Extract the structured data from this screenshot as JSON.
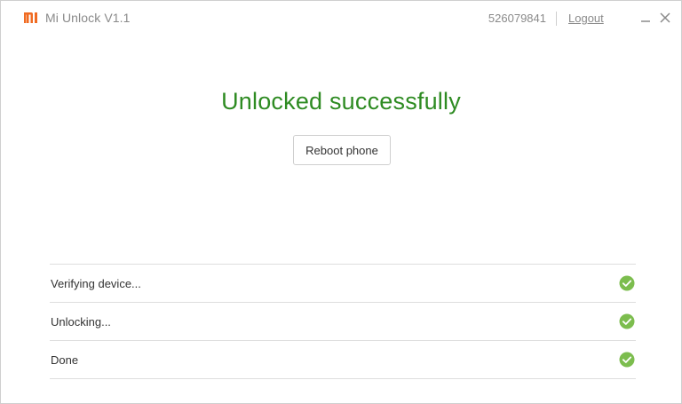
{
  "titlebar": {
    "logo_text": "MI",
    "app_title": "Mi Unlock  V1.1",
    "account_id": "526079841",
    "logout_label": "Logout",
    "brand_color": "#f06b22"
  },
  "main": {
    "status_title": "Unlocked successfully",
    "status_color": "#2e8b22",
    "reboot_label": "Reboot phone"
  },
  "steps": [
    {
      "label": "Verifying device...",
      "status": "complete",
      "icon": "check-circle-icon"
    },
    {
      "label": "Unlocking...",
      "status": "complete",
      "icon": "check-circle-icon"
    },
    {
      "label": "Done",
      "status": "complete",
      "icon": "check-circle-icon"
    }
  ],
  "check_color": "#7cbd4e"
}
